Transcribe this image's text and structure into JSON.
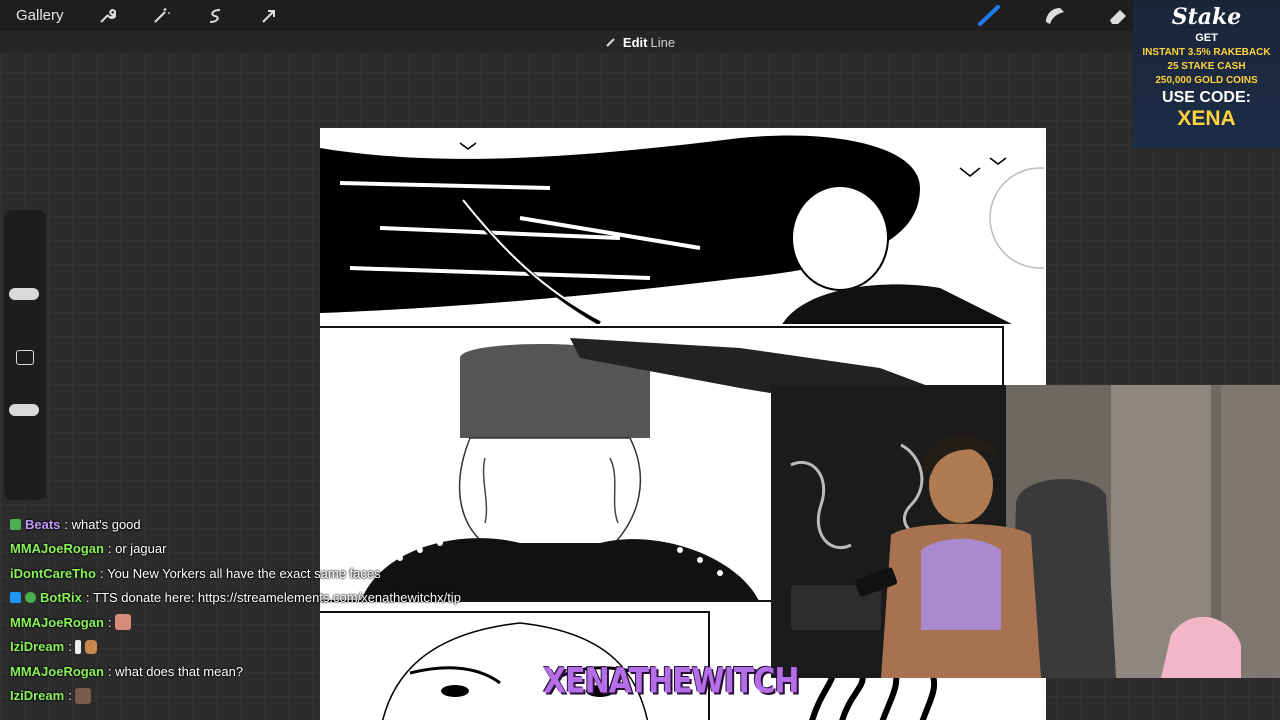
{
  "toolbar": {
    "gallery_label": "Gallery",
    "tools": [
      "wrench-icon",
      "magic-wand-icon",
      "selection-icon",
      "transform-arrow-icon"
    ],
    "right_tools": [
      "brush-icon",
      "smudge-icon",
      "eraser-icon"
    ]
  },
  "edit_bar": {
    "edit_label": "Edit",
    "mode_label": "Line"
  },
  "promo": {
    "logo": "Stake",
    "line_get": "GET",
    "line_rakeback": "INSTANT 3.5% RAKEBACK",
    "line_cash": "25 STAKE CASH",
    "line_coins": "250,000 GOLD COINS",
    "line_use": "USE CODE:",
    "code": "XENA"
  },
  "chat": [
    {
      "user": "Beats",
      "sep": ":",
      "text": "what's good",
      "color": "#c39cff"
    },
    {
      "user": "MMAJoeRogan",
      "sep": ":",
      "text": "or jaguar",
      "color": "#8af35b"
    },
    {
      "user": "iDontCareTho",
      "sep": ":",
      "text": "You New Yorkers all have the exact same faces",
      "color": "#8af35b"
    },
    {
      "user": "BotRix",
      "sep": ":",
      "text": "TTS donate here: https://streamelements.com/xenathewitchx/tip",
      "color": "#8af35b"
    },
    {
      "user": "MMAJoeRogan",
      "sep": ":",
      "text": "",
      "color": "#8af35b"
    },
    {
      "user": "IziDream",
      "sep": ":",
      "text": "",
      "color": "#8af35b"
    },
    {
      "user": "MMAJoeRogan",
      "sep": ":",
      "text": "what does that mean?",
      "color": "#8af35b"
    },
    {
      "user": "IziDream",
      "sep": ":",
      "text": "",
      "color": "#8af35b"
    }
  ],
  "banner": "XENATHEWITCH",
  "colors": {
    "accent_brush": "#1e7bf0",
    "chat_green": "#8af35b",
    "chat_purple": "#c39cff",
    "promo_yellow": "#ffd33d"
  }
}
